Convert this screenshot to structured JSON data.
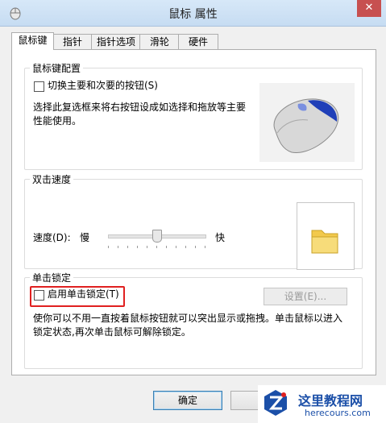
{
  "window": {
    "title": "鼠标 属性",
    "close_glyph": "✕"
  },
  "tabs": [
    {
      "label": "鼠标键",
      "active": true
    },
    {
      "label": "指针",
      "active": false
    },
    {
      "label": "指针选项",
      "active": false
    },
    {
      "label": "滑轮",
      "active": false
    },
    {
      "label": "硬件",
      "active": false
    }
  ],
  "button_config": {
    "title": "鼠标键配置",
    "switch_checkbox_label": "切换主要和次要的按钮(S)",
    "switch_checked": false,
    "description": "选择此复选框来将右按钮设成如选择和拖放等主要性能使用。"
  },
  "double_click": {
    "title": "双击速度",
    "speed_label": "速度(D):",
    "slow_label": "慢",
    "fast_label": "快",
    "speed_level": 0.5
  },
  "click_lock": {
    "title": "单击锁定",
    "checkbox_label": "启用单击锁定(T)",
    "checked": false,
    "settings_button": "设置(E)...",
    "description": "使你可以不用一直按着鼠标按钮就可以突出显示或拖拽。单击鼠标以进入锁定状态,再次单击鼠标可解除锁定。"
  },
  "footer": {
    "ok_button": "确定"
  },
  "watermark": {
    "title": "这里教程网",
    "url": "herecours.com"
  },
  "icons": [
    "mouse-properties-icon",
    "close-icon",
    "mouse-illustration-icon",
    "folder-icon",
    "watermark-logo-icon"
  ]
}
